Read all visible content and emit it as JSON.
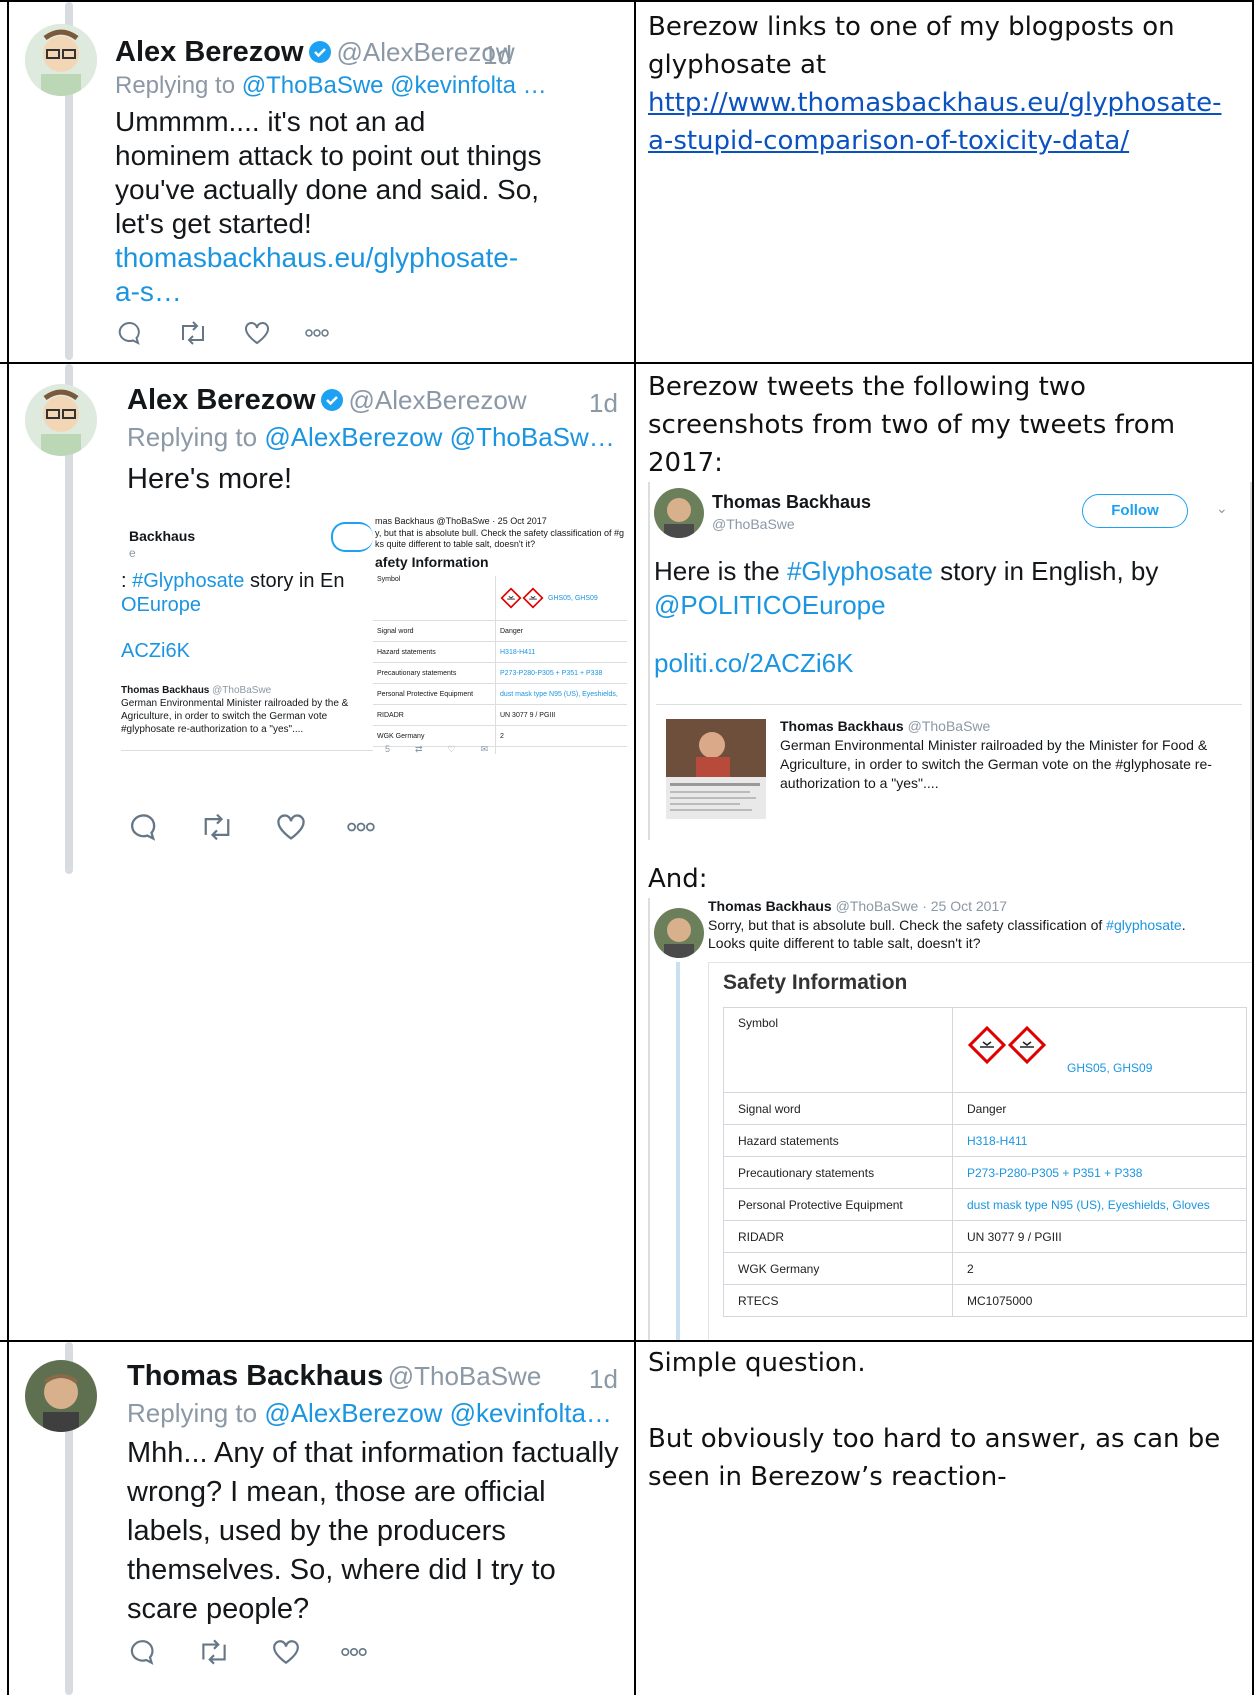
{
  "rows": [
    {
      "tweet": {
        "name": "Alex Berezow",
        "handle": "@AlexBerezow",
        "time": "1d",
        "reply_prefix": "Replying to",
        "reply_targets": "@ThoBaSwe @kevinfolta …",
        "body": "Ummmm.... it's not an ad hominem attack to point out things you've actually done and said. So, let's get started!",
        "link_line1": "thomasbackhaus.eu/glyphosate-",
        "link_line2": "a-s…"
      },
      "note": {
        "text": "Berezow links to one of my blogposts on glyphosate at",
        "link_line1": "http://www.thomasbackhaus.eu/glyphosate-",
        "link_line2": "a-stupid-comparison-of-toxicity-data/"
      }
    },
    {
      "tweet": {
        "name": "Alex Berezow",
        "handle": "@AlexBerezow",
        "time": "1d",
        "reply_prefix": "Replying to",
        "reply_targets": "@AlexBerezow @ThoBaSw…",
        "body": "Here's more!",
        "thumb_left": {
          "name": "Backhaus",
          "sub": "e",
          "text_a": "#Glyphosate",
          "text_b": " story in En",
          "text_c": "OEurope",
          "link": "ACZi6K",
          "quote_name": "Thomas Backhaus",
          "quote_handle": "@ThoBaSwe",
          "quote_text": "German Environmental Minister railroaded by the & Agriculture, in order to switch the German vote #glyphosate re-authorization to a \"yes\"...."
        },
        "thumb_right": {
          "header": "mas Backhaus @ThoBaSwe · 25 Oct 2017",
          "line1": "y, but that is absolute bull. Check the safety classification of #g",
          "line2": "ks quite different to table salt, doesn't it?",
          "title": "afety Information",
          "rows": [
            [
              "Symbol",
              "GHS05, GHS09"
            ],
            [
              "Signal word",
              "Danger"
            ],
            [
              "Hazard statements",
              "H318-H411"
            ],
            [
              "Precautionary statements",
              "P273-P280-P305 + P351 + P338"
            ],
            [
              "Personal Protective Equipment",
              "dust mask type N95 (US), Eyeshields,"
            ],
            [
              "RIDADR",
              "UN 3077 9 / PGIII"
            ],
            [
              "WGK Germany",
              "2"
            ],
            [
              "RTECS",
              "MC1075000"
            ]
          ]
        }
      },
      "note": {
        "text": "Berezow tweets the following two screenshots from two of my tweets from 2017:",
        "shot1": {
          "name": "Thomas Backhaus",
          "handle": "@ThoBaSwe",
          "follow": "Follow",
          "text_a": "Here is the ",
          "text_b": "#Glyphosate",
          "text_c": " story in English, by",
          "mention": "@POLITICOEurope",
          "link": "politi.co/2ACZi6K",
          "quote_name": "Thomas Backhaus",
          "quote_handle": "@ThoBaSwe",
          "quote_text": "German Environmental Minister railroaded by the Minister for Food & Agriculture, in order to switch the German vote on the #glyphosate re-authorization to a \"yes\"...."
        },
        "and": "And:",
        "shot2": {
          "name": "Thomas Backhaus",
          "handle": "@ThoBaSwe · 25 Oct 2017",
          "text_a": "Sorry, but that is absolute bull. Check the safety classification of ",
          "text_b": "#glyphosate",
          "text_c": ".",
          "text_d": "Looks quite different to table salt, doesn't it?",
          "title": "Safety Information",
          "rows": [
            [
              "Symbol",
              "GHS05, GHS09"
            ],
            [
              "Signal word",
              "Danger"
            ],
            [
              "Hazard statements",
              "H318-H411"
            ],
            [
              "Precautionary statements",
              "P273-P280-P305 + P351 + P338"
            ],
            [
              "Personal Protective Equipment",
              "dust mask type N95 (US), Eyeshields, Gloves"
            ],
            [
              "RIDADR",
              "UN 3077 9 / PGIII"
            ],
            [
              "WGK Germany",
              "2"
            ],
            [
              "RTECS",
              "MC1075000"
            ]
          ]
        }
      }
    },
    {
      "tweet": {
        "name": "Thomas Backhaus",
        "handle": "@ThoBaSwe",
        "time": "1d",
        "reply_prefix": "Replying to",
        "reply_targets": "@AlexBerezow @kevinfolta…",
        "body": "Mhh... Any of that information factually wrong? I mean, those are official labels, used by the producers themselves. So, where did I try to scare people?"
      },
      "note": {
        "line1": "Simple question.",
        "line2": "But obviously too hard to answer, as can be seen in Berezow’s reaction-"
      }
    }
  ],
  "colors": {
    "link_blue": "#1b95e0",
    "doc_link": "#0b52c1",
    "ghs_red": "#e00000"
  },
  "icons": [
    "reply-icon",
    "retweet-icon",
    "like-icon",
    "more-icon",
    "verified-icon",
    "ghs-pictogram-icon"
  ]
}
